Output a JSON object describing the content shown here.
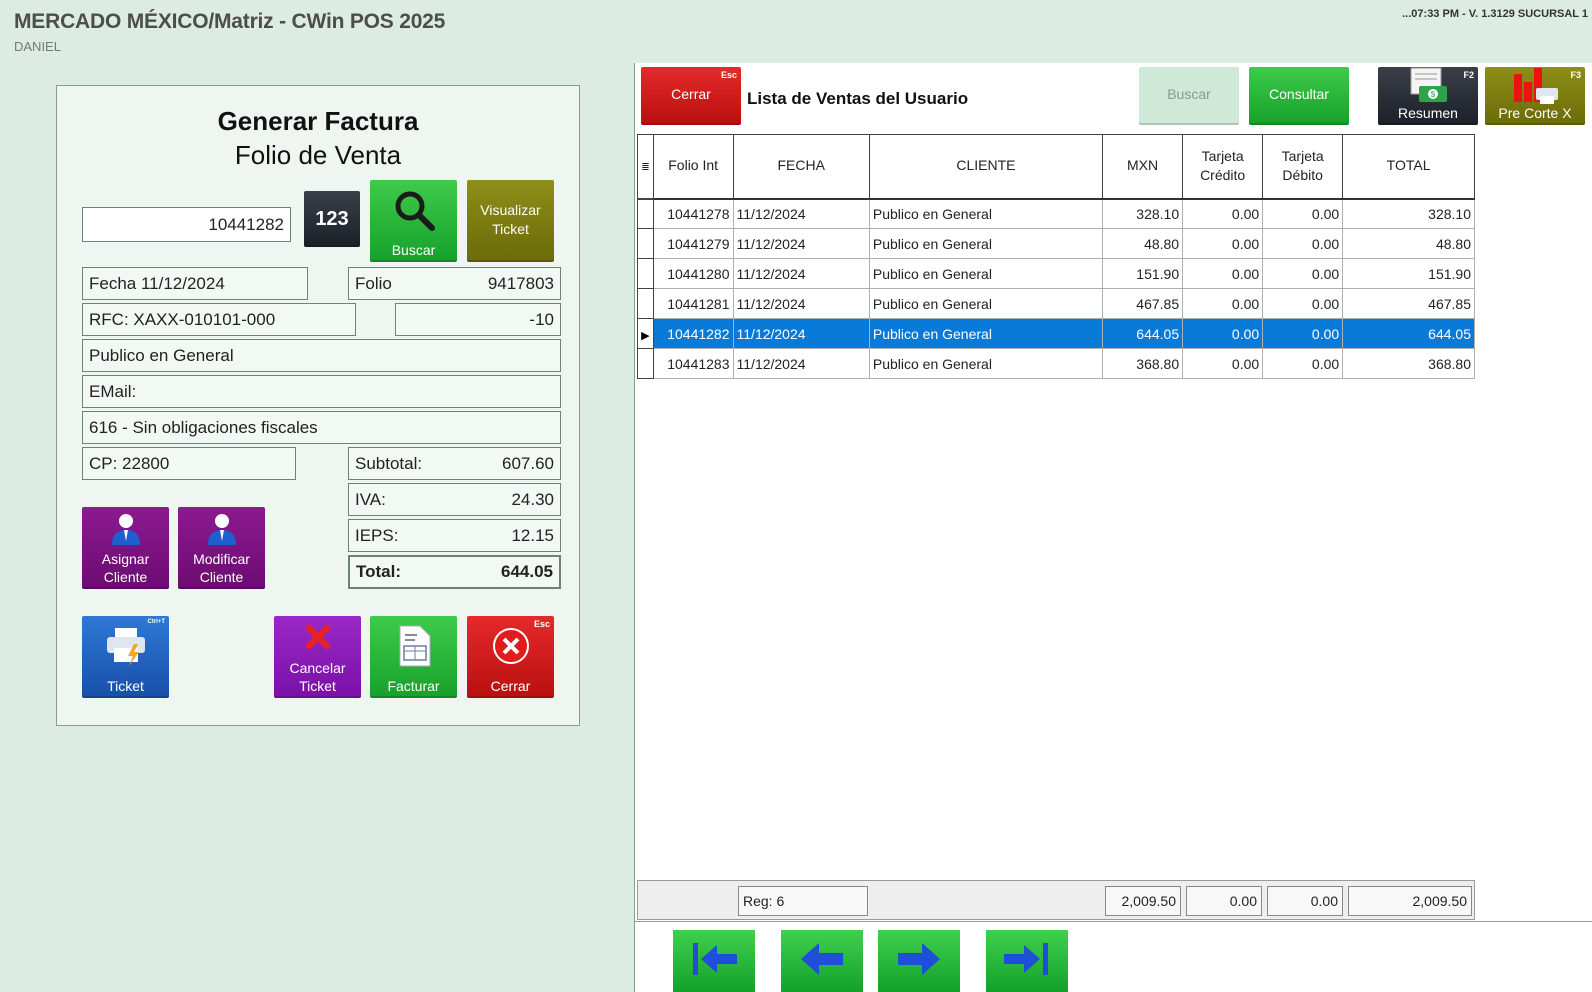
{
  "header": {
    "title": "MERCADO MÉXICO/Matriz - CWin POS 2025",
    "user": "DANIEL",
    "status": "...07:33 PM - V. 1.3129 SUCURSAL 1"
  },
  "factura": {
    "title": "Generar Factura",
    "subtitle": "Folio de Venta",
    "folio_input": "10441282",
    "keypad_label": "123",
    "buscar_label": "Buscar",
    "visualizar_label_1": "Visualizar",
    "visualizar_label_2": "Ticket",
    "fecha": "Fecha 11/12/2024",
    "folio_label": "Folio",
    "folio_value": "9417803",
    "rfc": "RFC: XAXX-010101-000",
    "rfc_extra": "-10",
    "cliente": "Publico en General",
    "email": "EMail:",
    "regimen": "616 - Sin obligaciones fiscales",
    "cp": "CP: 22800",
    "subtotal_label": "Subtotal:",
    "subtotal_value": "607.60",
    "iva_label": "IVA:",
    "iva_value": "24.30",
    "ieps_label": "IEPS:",
    "ieps_value": "12.15",
    "total_label": "Total:",
    "total_value": "644.05",
    "asignar_1": "Asignar",
    "asignar_2": "Cliente",
    "modificar_1": "Modificar",
    "modificar_2": "Cliente",
    "ticket_label": "Ticket",
    "ticket_key": "Ctrl+T",
    "cancelar_1": "Cancelar",
    "cancelar_2": "Ticket",
    "facturar_label": "Facturar",
    "cerrar_label": "Cerrar",
    "cerrar_key": "Esc"
  },
  "ventas": {
    "cerrar_label": "Cerrar",
    "cerrar_key": "Esc",
    "title": "Lista de Ventas del Usuario",
    "buscar_label": "Buscar",
    "consultar_label": "Consultar",
    "resumen_label": "Resumen",
    "resumen_key": "F2",
    "precorte_label": "Pre Corte X",
    "precorte_key": "F3",
    "columns": {
      "folio": "Folio Int",
      "fecha": "FECHA",
      "cliente": "CLIENTE",
      "mxn": "MXN",
      "tcredito_1": "Tarjeta",
      "tcredito_2": "Crédito",
      "tdebito_1": "Tarjeta",
      "tdebito_2": "Débito",
      "total": "TOTAL"
    },
    "rows": [
      {
        "folio": "10441278",
        "fecha": "11/12/2024",
        "cliente": "Publico en General",
        "mxn": "328.10",
        "tc": "0.00",
        "td": "0.00",
        "total": "328.10"
      },
      {
        "folio": "10441279",
        "fecha": "11/12/2024",
        "cliente": "Publico en General",
        "mxn": "48.80",
        "tc": "0.00",
        "td": "0.00",
        "total": "48.80"
      },
      {
        "folio": "10441280",
        "fecha": "11/12/2024",
        "cliente": "Publico en General",
        "mxn": "151.90",
        "tc": "0.00",
        "td": "0.00",
        "total": "151.90"
      },
      {
        "folio": "10441281",
        "fecha": "11/12/2024",
        "cliente": "Publico en General",
        "mxn": "467.85",
        "tc": "0.00",
        "td": "0.00",
        "total": "467.85"
      },
      {
        "folio": "10441282",
        "fecha": "11/12/2024",
        "cliente": "Publico en General",
        "mxn": "644.05",
        "tc": "0.00",
        "td": "0.00",
        "total": "644.05"
      },
      {
        "folio": "10441283",
        "fecha": "11/12/2024",
        "cliente": "Publico en General",
        "mxn": "368.80",
        "tc": "0.00",
        "td": "0.00",
        "total": "368.80"
      }
    ],
    "footer": {
      "reg": "Reg: 6",
      "mxn": "2,009.50",
      "tc": "0.00",
      "td": "0.00",
      "total": "2,009.50"
    }
  }
}
